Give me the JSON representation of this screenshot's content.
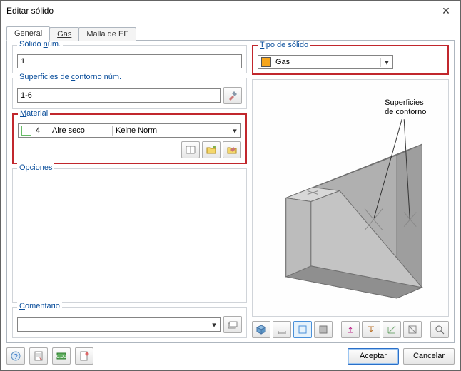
{
  "window": {
    "title": "Editar sólido",
    "close_glyph": "✕"
  },
  "tabs": {
    "general": "General",
    "gas": "Gas",
    "mesh": "Malla de EF"
  },
  "groups": {
    "solid_num": {
      "title_pre": "Sólido ",
      "title_u": "n",
      "title_post": "úm.",
      "value": "1"
    },
    "surfaces": {
      "title_pre": "Superficies de ",
      "title_u": "c",
      "title_post": "ontorno núm.",
      "value": "1-6"
    },
    "material": {
      "title_u": "M",
      "title_post": "aterial",
      "num": "4",
      "name": "Aire seco",
      "norm": "Keine Norm"
    },
    "options": {
      "title": "Opciones"
    },
    "comment": {
      "title_u": "C",
      "title_post": "omentario",
      "value": ""
    },
    "solid_type": {
      "title_u": "T",
      "title_post": "ipo de sólido",
      "value": "Gas",
      "swatch": "#f6a51c"
    }
  },
  "preview": {
    "label_line1": "Superficies",
    "label_line2": "de contorno"
  },
  "buttons": {
    "ok": "Aceptar",
    "cancel": "Cancelar"
  },
  "icons": {
    "pick": "pick",
    "library": "library",
    "new": "new",
    "edit": "edit",
    "comment_lib": "comment_lib",
    "help": "help",
    "notes": "notes",
    "units": "units",
    "script": "script"
  }
}
